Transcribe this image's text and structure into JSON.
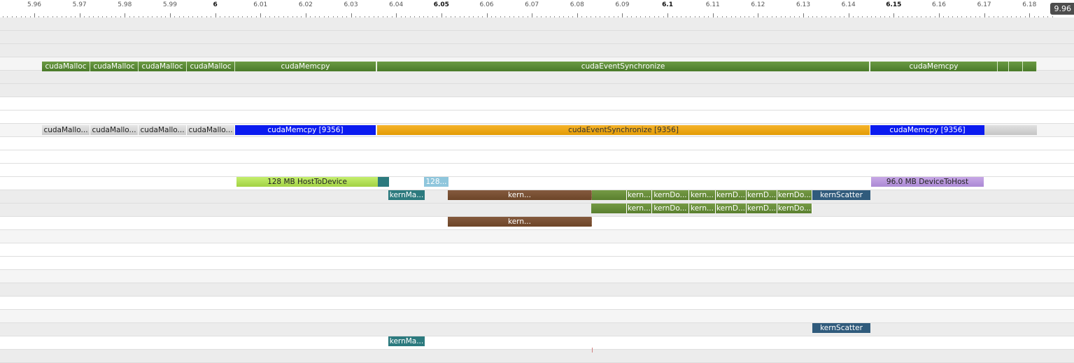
{
  "timeline": {
    "ticks": [
      {
        "label": "5.96",
        "bold": false
      },
      {
        "label": "5.97",
        "bold": false
      },
      {
        "label": "5.98",
        "bold": false
      },
      {
        "label": "5.99",
        "bold": false
      },
      {
        "label": "6",
        "bold": true
      },
      {
        "label": "6.01",
        "bold": false
      },
      {
        "label": "6.02",
        "bold": false
      },
      {
        "label": "6.03",
        "bold": false
      },
      {
        "label": "6.04",
        "bold": false
      },
      {
        "label": "6.05",
        "bold": true
      },
      {
        "label": "6.06",
        "bold": false
      },
      {
        "label": "6.07",
        "bold": false
      },
      {
        "label": "6.08",
        "bold": false
      },
      {
        "label": "6.09",
        "bold": false
      },
      {
        "label": "6.1",
        "bold": true
      },
      {
        "label": "6.11",
        "bold": false
      },
      {
        "label": "6.12",
        "bold": false
      },
      {
        "label": "6.13",
        "bold": false
      },
      {
        "label": "6.14",
        "bold": false
      },
      {
        "label": "6.15",
        "bold": true
      },
      {
        "label": "6.16",
        "bold": false
      },
      {
        "label": "6.17",
        "bold": false
      },
      {
        "label": "6.18",
        "bold": false
      }
    ],
    "corner_badge": "9.96"
  },
  "row_shading": [
    "#ececec",
    "#ececec",
    "#ececec",
    "#f5f5f5",
    "#ececec",
    "#ececec",
    "#ffffff",
    "#ffffff",
    "#f5f5f5",
    "#ffffff",
    "#ffffff",
    "#ffffff",
    "#ffffff",
    "#ececec",
    "#ececec",
    "#ffffff",
    "#f5f5f5",
    "#ffffff",
    "#ffffff",
    "#f5f5f5",
    "#ececec",
    "#ffffff",
    "#f5f5f5",
    "#ececec",
    "#ffffff",
    "#ececec"
  ],
  "rows": {
    "runtime_api": {
      "bars": [
        {
          "label": "cudaMalloc",
          "kind": "api"
        },
        {
          "label": "cudaMalloc",
          "kind": "api"
        },
        {
          "label": "cudaMalloc",
          "kind": "api"
        },
        {
          "label": "cudaMalloc",
          "kind": "api"
        },
        {
          "label": "cudaMemcpy",
          "kind": "api"
        },
        {
          "label": "cudaEventSynchronize",
          "kind": "api"
        },
        {
          "label": "cudaMemcpy",
          "kind": "api"
        },
        {
          "label": "",
          "kind": "api"
        },
        {
          "label": "",
          "kind": "api"
        },
        {
          "label": "",
          "kind": "api"
        }
      ]
    },
    "thread_api": {
      "bars": [
        {
          "label": "cudaMallo...",
          "kind": "thr"
        },
        {
          "label": "cudaMallo...",
          "kind": "thr"
        },
        {
          "label": "cudaMallo...",
          "kind": "thr"
        },
        {
          "label": "cudaMallo...",
          "kind": "thr"
        },
        {
          "label": "cudaMemcpy [9356]",
          "kind": "memcpy"
        },
        {
          "label": "cudaEventSynchronize [9356]",
          "kind": "sync"
        },
        {
          "label": "cudaMemcpy [9356]",
          "kind": "memcpy"
        },
        {
          "label": "",
          "kind": "grey"
        },
        {
          "label": "",
          "kind": "grey"
        }
      ]
    },
    "memory": {
      "bars": [
        {
          "label": "128 MB HostToDevice",
          "kind": "htod"
        },
        {
          "label": "",
          "kind": "teal"
        },
        {
          "label": "128...",
          "kind": "lblue"
        },
        {
          "label": "96.0 MB DeviceToHost",
          "kind": "dtoh"
        }
      ]
    },
    "kernels_a": {
      "bars": [
        {
          "label": "kernMa...",
          "kind": "teal"
        },
        {
          "label": "kern...",
          "kind": "brown"
        },
        {
          "label": "",
          "kind": "olive"
        },
        {
          "label": "kern...",
          "kind": "olive"
        },
        {
          "label": "kernDo...",
          "kind": "olive"
        },
        {
          "label": "kern...",
          "kind": "olive"
        },
        {
          "label": "kernD...",
          "kind": "olive"
        },
        {
          "label": "kernD...",
          "kind": "olive"
        },
        {
          "label": "kernDo...",
          "kind": "olive"
        },
        {
          "label": "kernScatter",
          "kind": "scatter"
        }
      ]
    },
    "kernels_b": {
      "bars": [
        {
          "label": "",
          "kind": "olive"
        },
        {
          "label": "kern...",
          "kind": "olive"
        },
        {
          "label": "kernDo...",
          "kind": "olive"
        },
        {
          "label": "kern...",
          "kind": "olive"
        },
        {
          "label": "kernD...",
          "kind": "olive"
        },
        {
          "label": "kernD...",
          "kind": "olive"
        },
        {
          "label": "kernDo...",
          "kind": "olive"
        }
      ]
    },
    "kernels_c": {
      "bars": [
        {
          "label": "kern...",
          "kind": "brown"
        }
      ]
    },
    "kernels_d": {
      "bars": [
        {
          "label": "kernScatter",
          "kind": "scatter"
        }
      ]
    },
    "kernels_e": {
      "bars": [
        {
          "label": "kernMa...",
          "kind": "teal"
        }
      ]
    }
  }
}
